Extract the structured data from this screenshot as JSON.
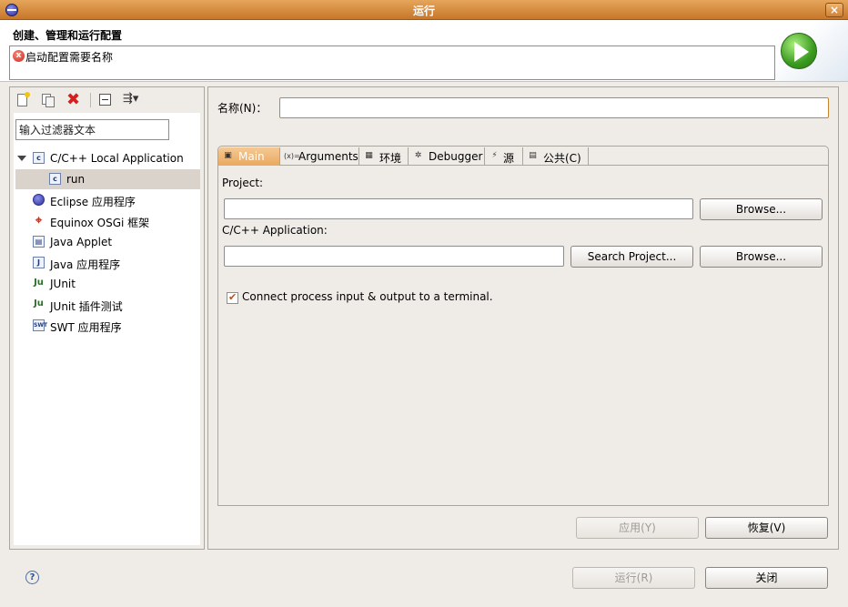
{
  "window": {
    "title": "运行",
    "close_glyph": "×"
  },
  "header": {
    "title": "创建、管理和运行配置",
    "message": "启动配置需要名称",
    "error_glyph": "x"
  },
  "left_toolbar": [
    "new-config-icon",
    "duplicate-icon",
    "delete-icon",
    "collapse-all-icon",
    "filter-menu-icon"
  ],
  "filter": {
    "value": "输入过滤器文本"
  },
  "tree": {
    "root": {
      "label": "C/C++ Local Application",
      "icon_text": "c"
    },
    "child": {
      "label": "run",
      "icon_text": "c"
    },
    "items": [
      {
        "label": "Eclipse 应用程序",
        "icon_text": ""
      },
      {
        "label": "Equinox OSGi 框架",
        "icon_text": "⌖"
      },
      {
        "label": "Java Applet",
        "icon_text": "▤"
      },
      {
        "label": "Java 应用程序",
        "icon_text": "J"
      },
      {
        "label": "JUnit",
        "icon_text": "Ju"
      },
      {
        "label": "JUnit 插件测试",
        "icon_text": "Ju"
      },
      {
        "label": "SWT 应用程序",
        "icon_text": "SWT"
      }
    ]
  },
  "name": {
    "label": "名称(N)：",
    "value": ""
  },
  "tabs": [
    {
      "label": "Main",
      "icon_text": "▣"
    },
    {
      "label": "Arguments",
      "icon_text": "(x)="
    },
    {
      "label": "环境",
      "icon_text": "▦"
    },
    {
      "label": "Debugger",
      "icon_text": "✲"
    },
    {
      "label": "源",
      "icon_text": "⚡"
    },
    {
      "label": "公共(C)",
      "icon_text": "▤"
    }
  ],
  "main_tab": {
    "project_label": "Project:",
    "project_value": "",
    "browse1": "Browse...",
    "app_label": "C/C++ Application:",
    "app_value": "",
    "search_project": "Search Project...",
    "browse2": "Browse...",
    "terminal_label": "Connect process input & output to a terminal."
  },
  "buttons": {
    "apply": "应用(Y)",
    "revert": "恢复(V)",
    "run": "运行(R)",
    "close": "关闭"
  },
  "help_glyph": "?"
}
